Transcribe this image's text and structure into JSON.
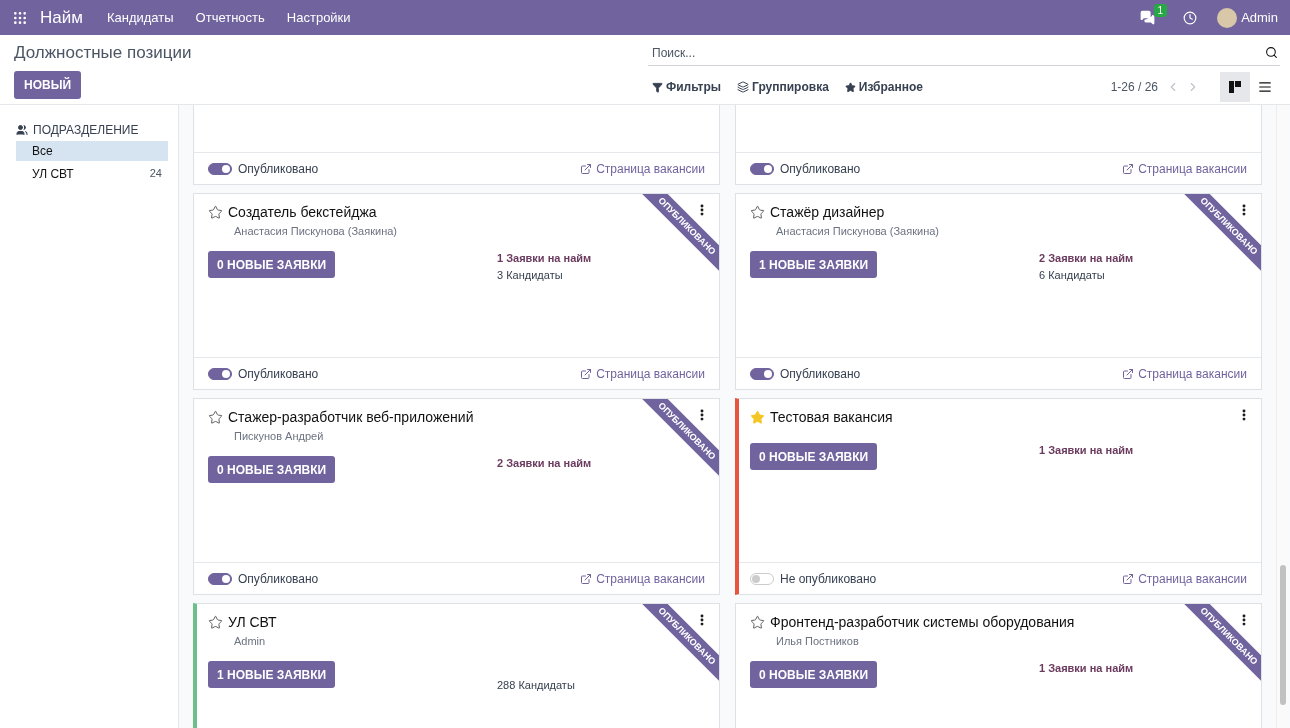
{
  "topbar": {
    "app": "Найм",
    "menu": [
      "Кандидаты",
      "Отчетность",
      "Настройки"
    ],
    "messages_badge": "1",
    "user": "Admin"
  },
  "control_panel": {
    "title": "Должностные позиции",
    "new_button": "НОВЫЙ",
    "search": {
      "placeholder": "Поиск..."
    },
    "filters": [
      {
        "kind": "filter",
        "label": "Фильтры"
      },
      {
        "kind": "group",
        "label": "Группировка"
      },
      {
        "kind": "favorite",
        "label": "Избранное"
      }
    ],
    "pager": "1-26 / 26",
    "views": [
      {
        "kind": "kanban",
        "selected": true
      },
      {
        "kind": "list",
        "selected": false
      }
    ]
  },
  "sidebar": {
    "heading": "ПОДРАЗДЕЛЕНИЕ",
    "items": [
      {
        "label": "Все",
        "selected": true
      },
      {
        "label": "УЛ СВТ",
        "count": "24",
        "selected": false
      }
    ]
  },
  "cards": [
    {
      "kind": "cut_top",
      "footer": {
        "published": true,
        "status": "Опубликовано",
        "link": "Страница вакансии"
      }
    },
    {
      "kind": "cut_top",
      "footer": {
        "published": true,
        "status": "Опубликовано",
        "link": "Страница вакансии"
      }
    },
    {
      "kind": "full",
      "title": "Создатель бекстейджа",
      "favorite": false,
      "manager": "Анастасия Пискунова (Заякина)",
      "new_button": "0 НОВЫЕ ЗАЯВКИ",
      "stats": [
        {
          "kind": "hire",
          "text": "1 Заявки на найм"
        },
        {
          "kind": "candidates",
          "text": "3 Кандидаты"
        }
      ],
      "ribbon": "ОПУБЛИКОВАНО",
      "footer": {
        "published": true,
        "status": "Опубликовано",
        "link": "Страница вакансии"
      }
    },
    {
      "kind": "full",
      "title": "Стажёр дизайнер",
      "favorite": false,
      "manager": "Анастасия Пискунова (Заякина)",
      "new_button": "1 НОВЫЕ ЗАЯВКИ",
      "stats": [
        {
          "kind": "hire",
          "text": "2 Заявки на найм"
        },
        {
          "kind": "candidates",
          "text": "6 Кандидаты"
        }
      ],
      "ribbon": "ОПУБЛИКОВАНО",
      "footer": {
        "published": true,
        "status": "Опубликовано",
        "link": "Страница вакансии"
      }
    },
    {
      "kind": "full",
      "title": "Стажер-разработчик веб-приложений",
      "favorite": false,
      "manager": "Пискунов Андрей",
      "new_button": "0 НОВЫЕ ЗАЯВКИ",
      "stats": [
        {
          "kind": "hire",
          "text": "2 Заявки на найм"
        }
      ],
      "ribbon": "ОПУБЛИКОВАНО",
      "footer": {
        "published": true,
        "status": "Опубликовано",
        "link": "Страница вакансии"
      }
    },
    {
      "kind": "full",
      "title": "Тестовая вакансия",
      "favorite": true,
      "color": "#e8543e",
      "new_button": "0 НОВЫЕ ЗАЯВКИ",
      "stats": [
        {
          "kind": "hire",
          "text": "1 Заявки на найм"
        }
      ],
      "footer": {
        "published": false,
        "status": "Не опубликовано",
        "link": "Страница вакансии"
      }
    },
    {
      "kind": "full",
      "title": "УЛ СВТ",
      "favorite": false,
      "color": "#6cc18a",
      "manager": "Admin",
      "new_button": "1 НОВЫЕ ЗАЯВКИ",
      "stats": [
        {
          "kind": "candidates",
          "text": "288 Кандидаты"
        }
      ],
      "ribbon": "ОПУБЛИКОВАНО"
    },
    {
      "kind": "full",
      "title": "Фронтенд-разработчик системы оборудования",
      "favorite": false,
      "manager": "Илья Постников",
      "new_button": "0 НОВЫЕ ЗАЯВКИ",
      "stats": [
        {
          "kind": "hire",
          "text": "1 Заявки на найм"
        }
      ],
      "ribbon": "ОПУБЛИКОВАНО"
    }
  ]
}
